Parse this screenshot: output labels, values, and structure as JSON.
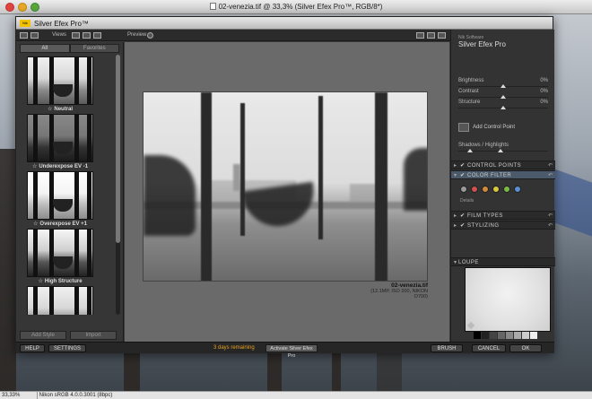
{
  "window": {
    "title": "02-venezia.tif @ 33,3% (Silver Efex Pro™, RGB/8*)"
  },
  "plugin": {
    "title": "Silver Efex Pro™",
    "logo_text": "Nik"
  },
  "toolbar": {
    "views_label": "Views",
    "preview_label": "Preview"
  },
  "left_panel": {
    "tabs": [
      {
        "label": "All"
      },
      {
        "label": "Favorites"
      }
    ],
    "presets": [
      {
        "label": "Neutral"
      },
      {
        "label": "Underexpose EV -1"
      },
      {
        "label": "Overexpose EV +1"
      },
      {
        "label": "High Structure"
      },
      {
        "label": ""
      }
    ],
    "add_style_label": "Add Style",
    "import_label": "Import"
  },
  "preview": {
    "file_name": "02-venezia.tif",
    "file_info": "(12.1MP, ISO 200, NIKON D700)"
  },
  "right_panel": {
    "brand_small": "Nik Software",
    "brand_big": "Silver Efex Pro",
    "sliders": [
      {
        "label": "Brightness",
        "value": "0%"
      },
      {
        "label": "Contrast",
        "value": "0%"
      },
      {
        "label": "Structure",
        "value": "0%"
      }
    ],
    "add_control_point_label": "Add Control Point",
    "shadows_highlights_label": "Shadows / Highlights",
    "sections": [
      {
        "title": "CONTROL POINTS"
      },
      {
        "title": "COLOR FILTER"
      },
      {
        "title": "FILM TYPES"
      },
      {
        "title": "STYLIZING"
      }
    ],
    "details_label": "Details",
    "filter_colors": [
      "#9a9a9a",
      "#d05050",
      "#d08a3a",
      "#d8c840",
      "#7ab848",
      "#5a90d0"
    ],
    "loupe_label": "LOUPE"
  },
  "bottom_bar": {
    "help_label": "HELP",
    "settings_label": "SETTINGS",
    "trial_text": "3 days remaining",
    "activate_label": "Activate Silver Efex Pro",
    "brush_label": "BRUSH",
    "cancel_label": "CANCEL",
    "ok_label": "OK"
  },
  "status_bar": {
    "zoom": "33,33%",
    "profile": "Nikon sRGB 4.0.0.3001 (8bpc)"
  }
}
